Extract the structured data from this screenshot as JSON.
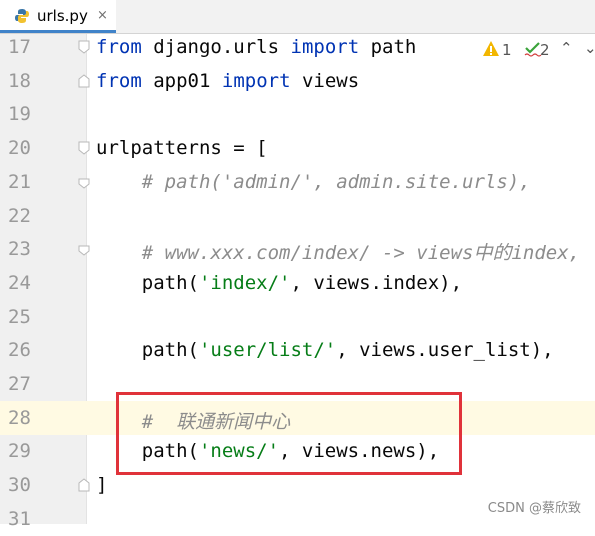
{
  "tab": {
    "filename": "urls.py",
    "close": "×"
  },
  "status": {
    "warnings": "1",
    "checks": "2"
  },
  "lines": [
    {
      "n": "17",
      "tokens": [
        [
          "kw",
          "from"
        ],
        [
          "",
          "django.urls"
        ],
        [
          "kw",
          "import"
        ],
        [
          "",
          "path"
        ]
      ]
    },
    {
      "n": "18",
      "tokens": [
        [
          "kw",
          "from"
        ],
        [
          "",
          "app01"
        ],
        [
          "kw",
          "import"
        ],
        [
          "",
          "views"
        ]
      ]
    },
    {
      "n": "19",
      "tokens": []
    },
    {
      "n": "20",
      "tokens": [
        [
          "",
          "urlpatterns = ["
        ]
      ]
    },
    {
      "n": "21",
      "tokens": [
        [
          "cmt",
          "    # path('admin/', admin.site.urls),"
        ]
      ]
    },
    {
      "n": "22",
      "tokens": []
    },
    {
      "n": "23",
      "tokens": [
        [
          "cmt",
          "    # www.xxx.com/index/ -> views中的index,"
        ]
      ]
    },
    {
      "n": "24",
      "tokens": [
        [
          "",
          "    path("
        ],
        [
          "str",
          "'index/'"
        ],
        [
          "",
          ", views.index),"
        ]
      ]
    },
    {
      "n": "25",
      "tokens": []
    },
    {
      "n": "26",
      "tokens": [
        [
          "",
          "    path("
        ],
        [
          "str",
          "'user/list/'"
        ],
        [
          "",
          ", views.user_list),"
        ]
      ]
    },
    {
      "n": "27",
      "tokens": []
    },
    {
      "n": "28",
      "tokens": [
        [
          "cmt",
          "    #  联通新闻中心"
        ]
      ]
    },
    {
      "n": "29",
      "tokens": [
        [
          "",
          "    path("
        ],
        [
          "str",
          "'news/'"
        ],
        [
          "",
          ", views.news),"
        ]
      ]
    },
    {
      "n": "30",
      "tokens": [
        [
          "",
          "]"
        ]
      ]
    },
    {
      "n": "31",
      "tokens": []
    }
  ],
  "watermark": "CSDN @蔡欣致"
}
